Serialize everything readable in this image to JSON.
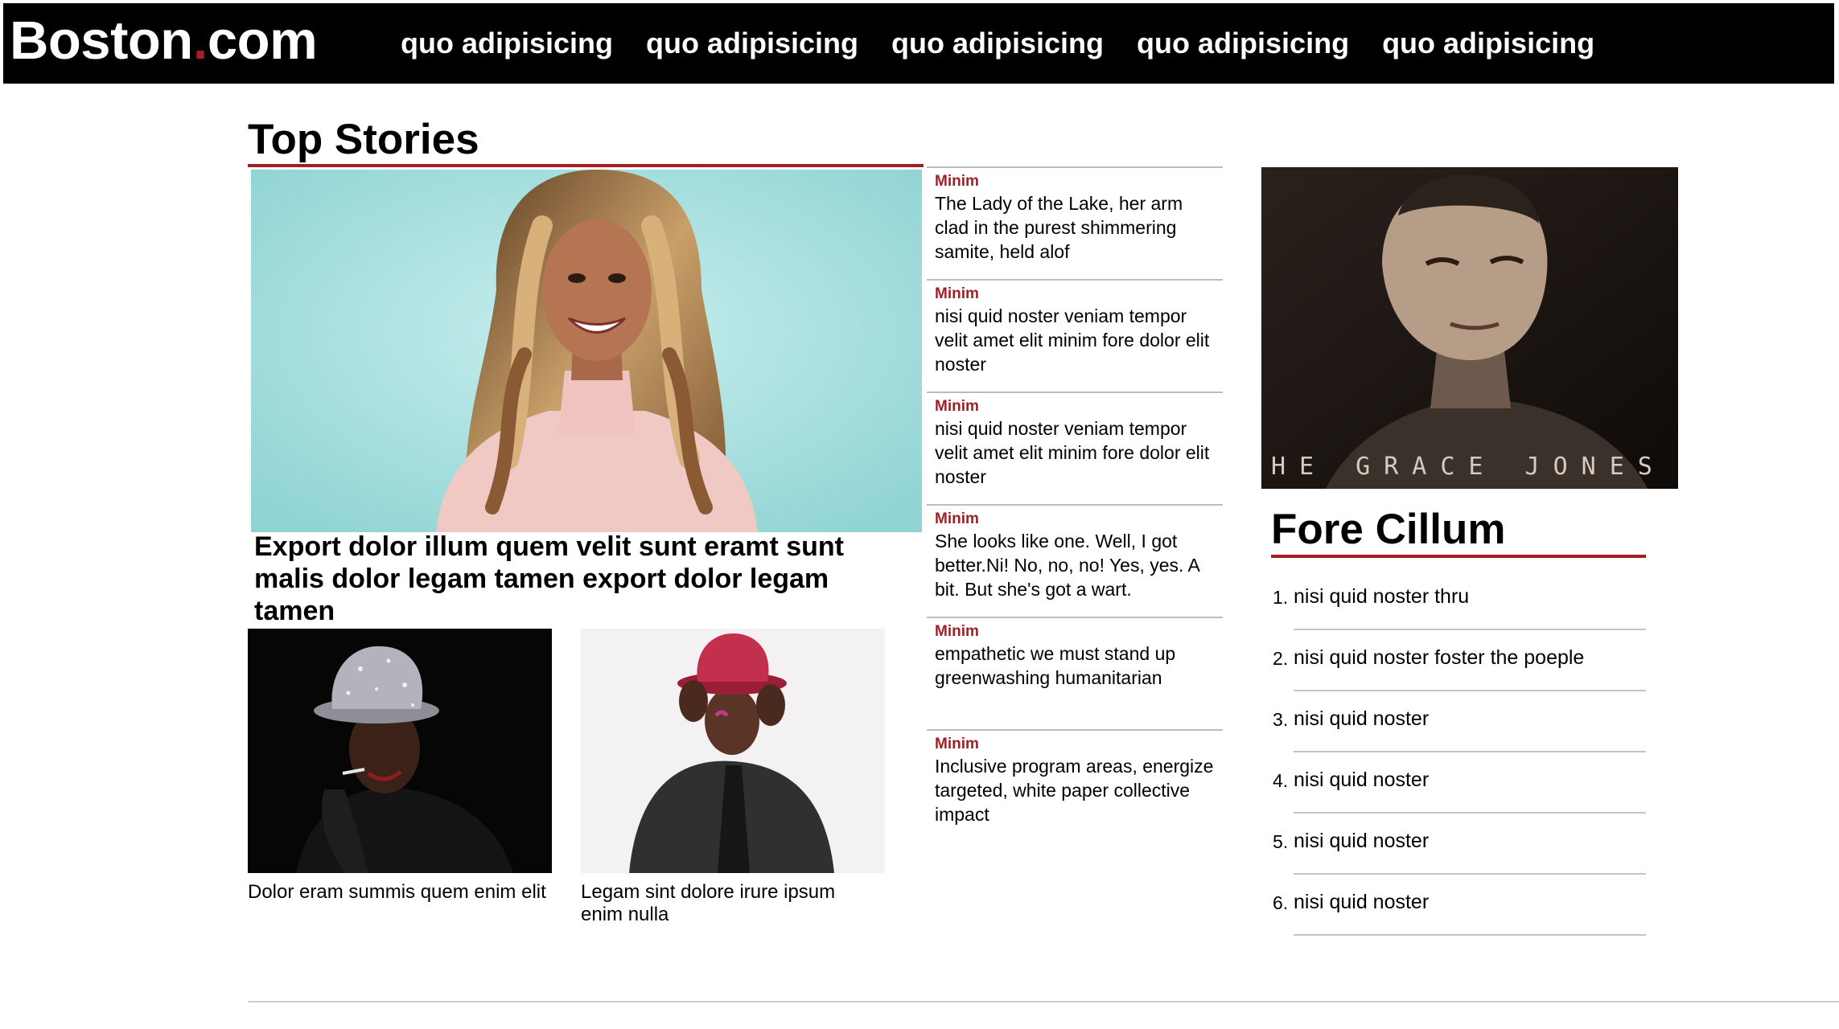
{
  "header": {
    "logo": {
      "main": "Boston",
      "dot": ".",
      "suffix": "com"
    },
    "nav": [
      "quo adipisicing",
      "quo adipisicing",
      "quo adipisicing",
      "quo adipisicing",
      "quo adipisicing"
    ]
  },
  "top_stories": {
    "title": "Top Stories",
    "lead": {
      "headline": "Export dolor illum quem velit sunt eramt sunt malis dolor legam tamen export dolor legam tamen"
    },
    "secondary": [
      {
        "caption": "Dolor eram summis quem enim elit"
      },
      {
        "caption": "Legam sint dolore irure ipsum enim nulla"
      }
    ]
  },
  "mid_list": [
    {
      "kicker": "Minim",
      "text": "The Lady of the Lake, her arm clad in the purest shimmering samite, held alof"
    },
    {
      "kicker": "Minim",
      "text": "nisi quid noster veniam tempor velit amet elit minim fore dolor elit noster"
    },
    {
      "kicker": "Minim",
      "text": "nisi quid noster veniam tempor velit amet elit minim fore dolor elit noster"
    },
    {
      "kicker": "Minim",
      "text": "She looks like one. Well, I got better.Ni! No, no, no! Yes, yes. A bit. But she's got a wart."
    },
    {
      "kicker": "Minim",
      "text": "empathetic we must stand up greenwashing humanitarian"
    },
    {
      "kicker": "Minim",
      "text": "Inclusive program areas, energize targeted, white paper collective impact"
    }
  ],
  "sidebar": {
    "image_text": "HE GRACE JONES STOR",
    "title": "Fore Cillum",
    "items": [
      {
        "num": "1.",
        "text": "nisi quid noster thru"
      },
      {
        "num": "2.",
        "text": "nisi quid noster foster the poeple"
      },
      {
        "num": "3.",
        "text": "nisi quid noster"
      },
      {
        "num": "4.",
        "text": "nisi quid noster"
      },
      {
        "num": "5.",
        "text": "nisi quid noster"
      },
      {
        "num": "6.",
        "text": "nisi quid noster"
      }
    ]
  },
  "colors": {
    "accent": "#a31f24",
    "nav_bg": "#000000",
    "divider": "#c4c4c4"
  }
}
